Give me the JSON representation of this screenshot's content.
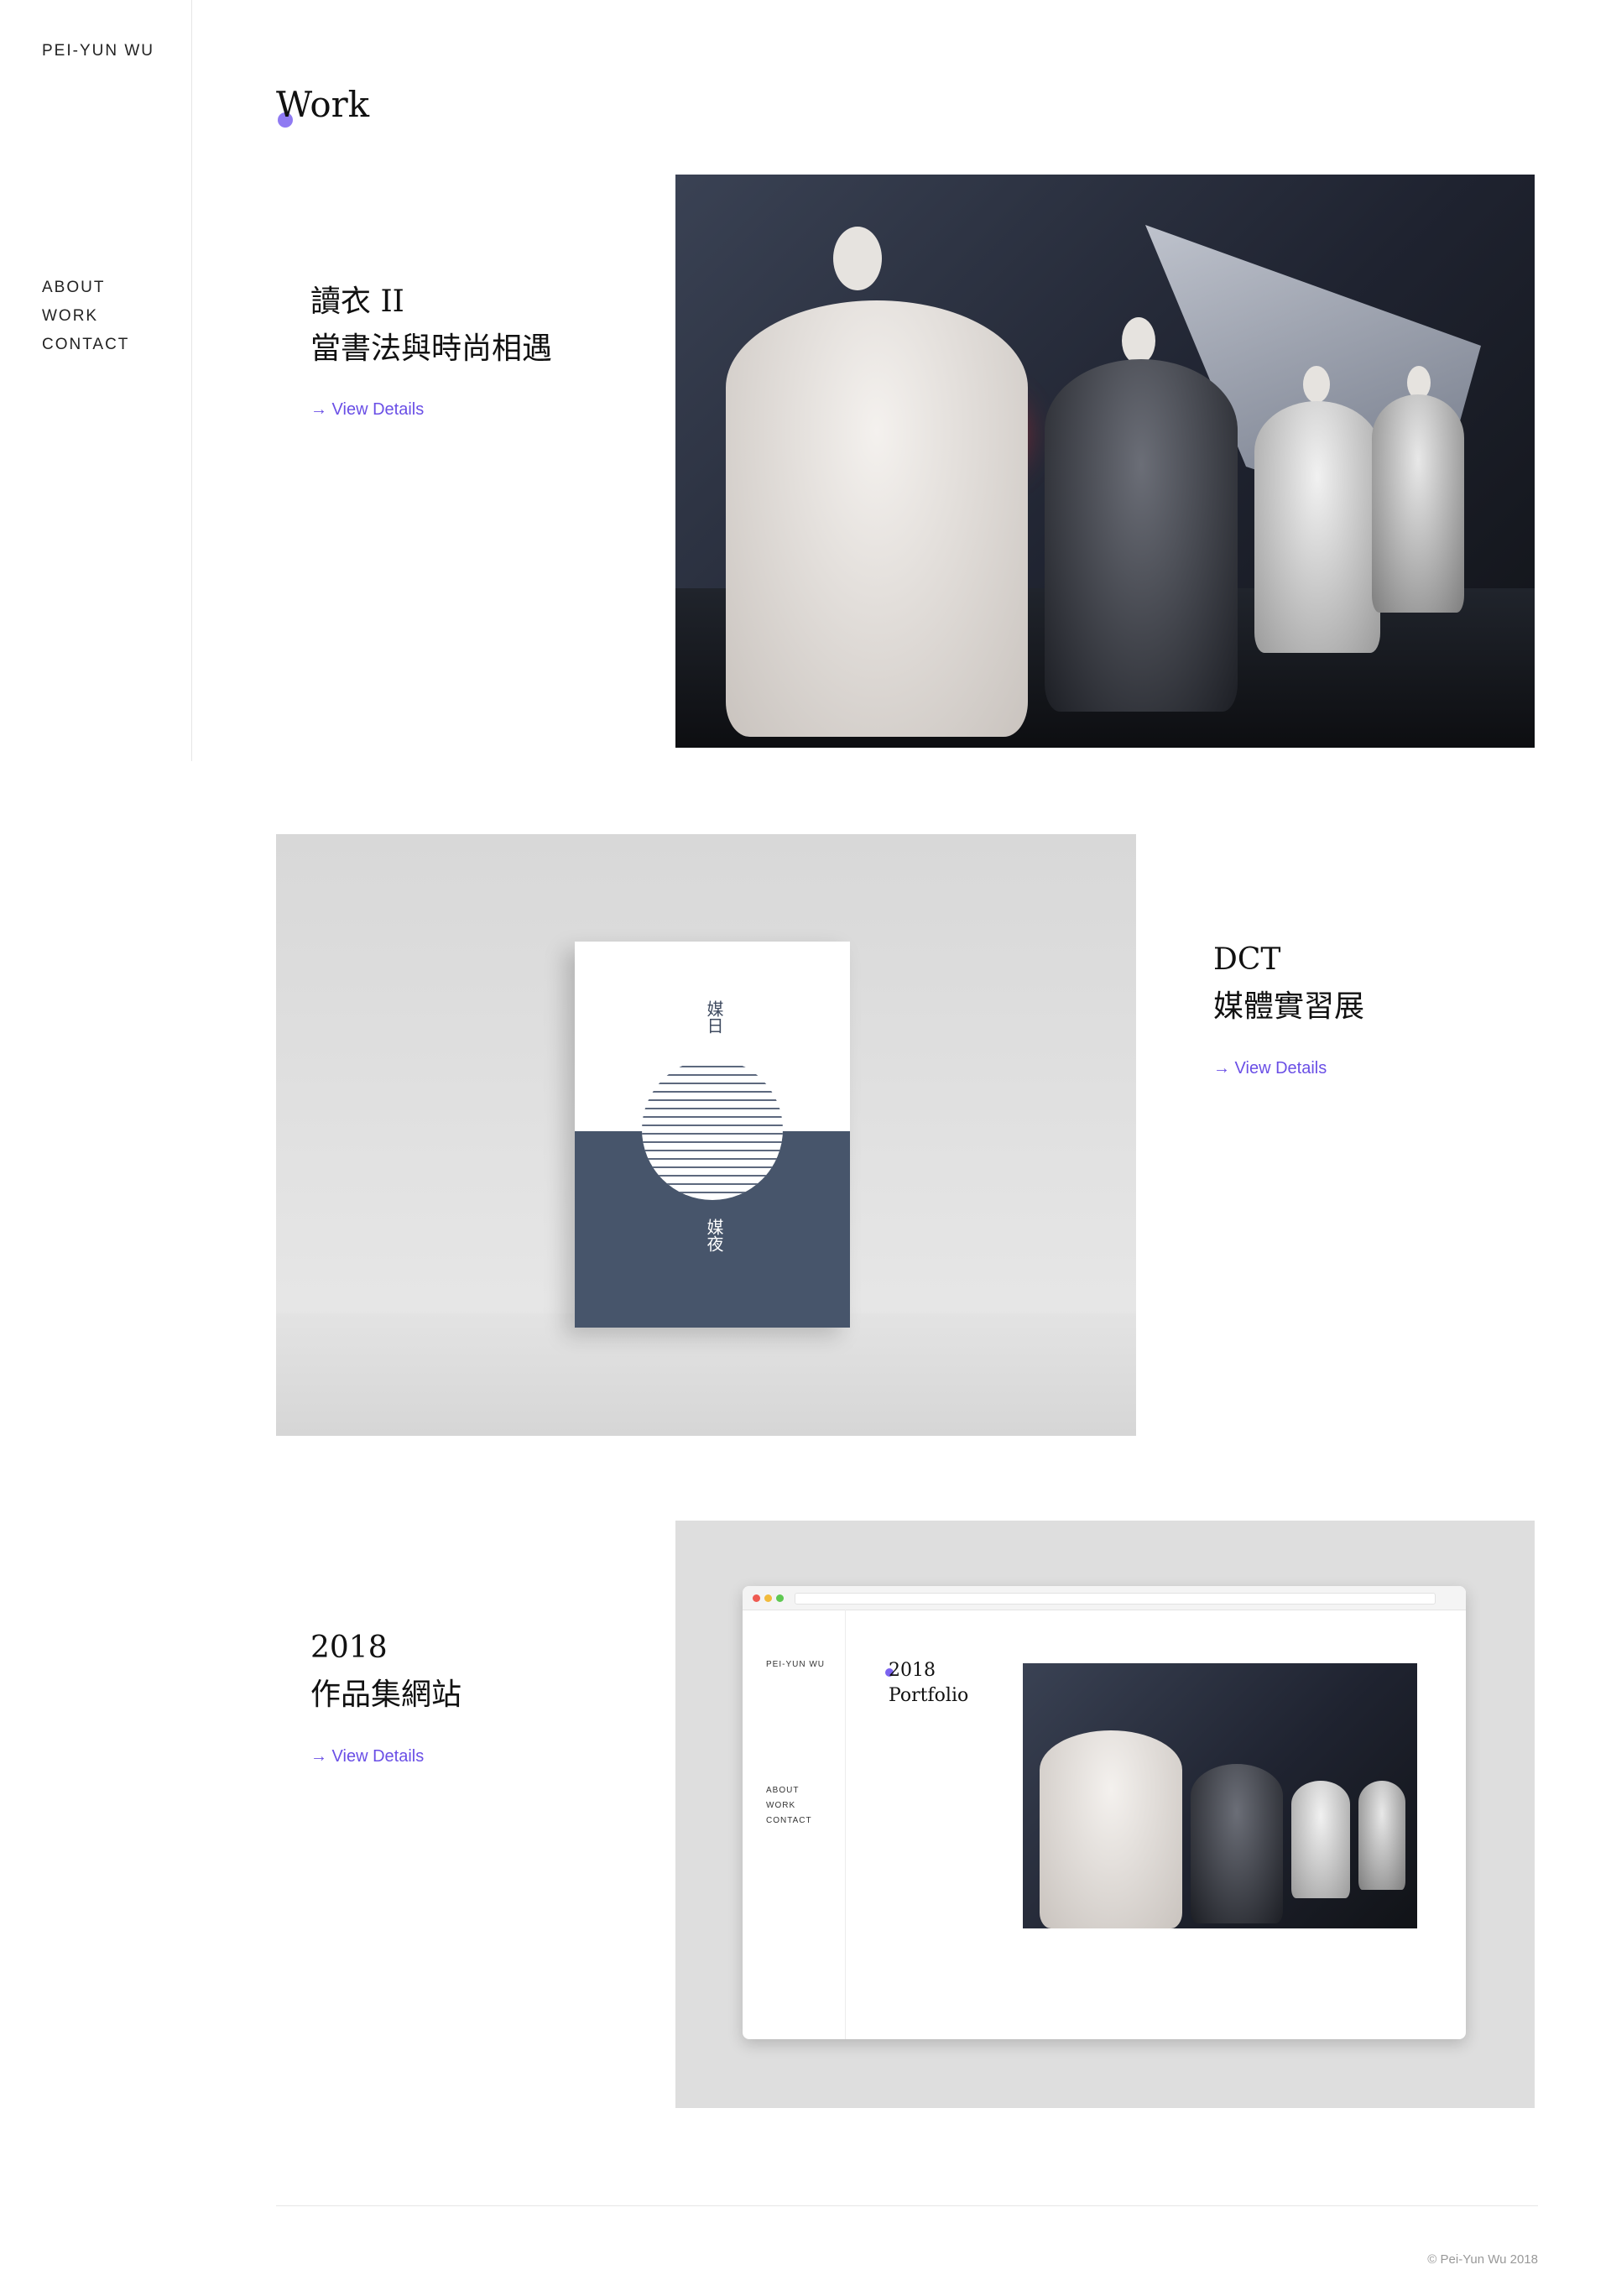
{
  "sidebar": {
    "brand": "PEI-YUN WU",
    "nav": [
      "ABOUT",
      "WORK",
      "CONTACT"
    ]
  },
  "page": {
    "title": "Work"
  },
  "projects": [
    {
      "title_line1": "讀衣 II",
      "title_line2": "當書法與時尚相遇",
      "link": "→ View Details"
    },
    {
      "title_line1": "DCT",
      "title_line2": "媒體實習展",
      "link": "→ View Details",
      "poster": {
        "top_text": "媒日",
        "bottom_text": "媒夜"
      }
    },
    {
      "title_line1": "2018",
      "title_line2": "作品集網站",
      "link": "→ View Details",
      "browser": {
        "brand": "PEI-YUN WU",
        "nav": [
          "ABOUT",
          "WORK",
          "CONTACT"
        ],
        "title_line1": "2018",
        "title_line2": "Portfolio"
      }
    }
  ],
  "footer": {
    "copyright": "© Pei-Yun Wu 2018"
  },
  "colors": {
    "accent": "#6a4fe6",
    "poster_navy": "#47556b"
  }
}
